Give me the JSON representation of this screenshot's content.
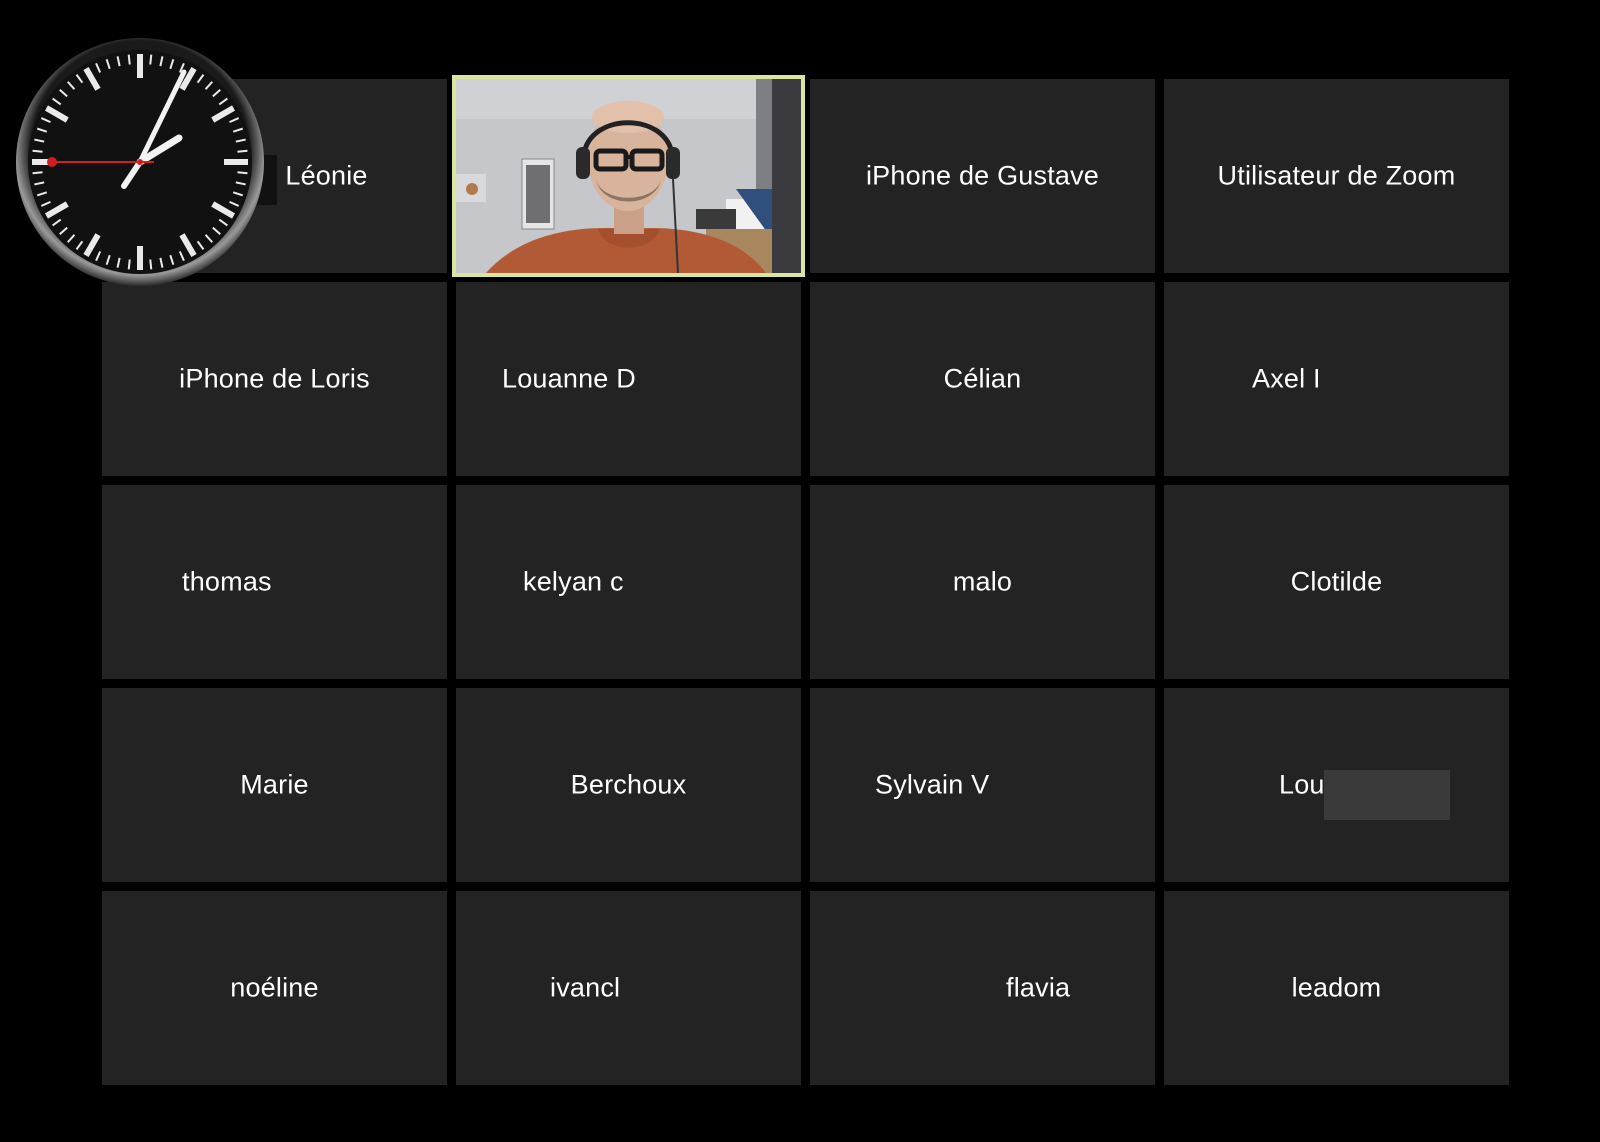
{
  "meeting": {
    "participants": [
      {
        "name": "Léonie"
      },
      {
        "name": "",
        "video": true
      },
      {
        "name": "iPhone de Gustave"
      },
      {
        "name": "Utilisateur de Zoom"
      },
      {
        "name": "iPhone de Loris"
      },
      {
        "name": "Louanne D"
      },
      {
        "name": "Célian"
      },
      {
        "name": "Axel I"
      },
      {
        "name": "thomas"
      },
      {
        "name": "kelyan c"
      },
      {
        "name": "malo"
      },
      {
        "name": "Clotilde"
      },
      {
        "name": "Marie"
      },
      {
        "name": "Berchoux"
      },
      {
        "name": "Sylvain V"
      },
      {
        "name": "Lou"
      },
      {
        "name": "noéline"
      },
      {
        "name": "ivancl"
      },
      {
        "name": "flavia"
      },
      {
        "name": "leadom"
      }
    ],
    "active_speaker_border_color": "#d8e6a0",
    "tile_background": "#232323"
  },
  "clock_overlay": {
    "icon": "analog-clock-icon"
  }
}
